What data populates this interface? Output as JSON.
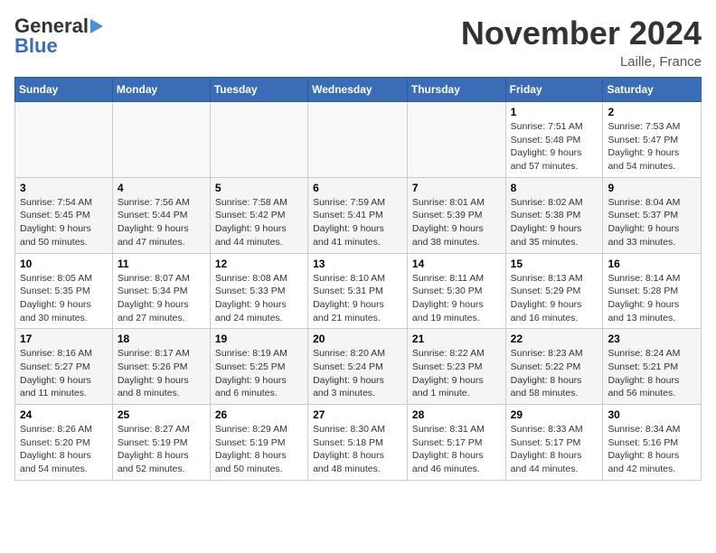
{
  "logo": {
    "line1": "General",
    "line2": "Blue"
  },
  "title": "November 2024",
  "location": "Laille, France",
  "days_of_week": [
    "Sunday",
    "Monday",
    "Tuesday",
    "Wednesday",
    "Thursday",
    "Friday",
    "Saturday"
  ],
  "weeks": [
    [
      {
        "num": "",
        "info": ""
      },
      {
        "num": "",
        "info": ""
      },
      {
        "num": "",
        "info": ""
      },
      {
        "num": "",
        "info": ""
      },
      {
        "num": "",
        "info": ""
      },
      {
        "num": "1",
        "info": "Sunrise: 7:51 AM\nSunset: 5:48 PM\nDaylight: 9 hours and 57 minutes."
      },
      {
        "num": "2",
        "info": "Sunrise: 7:53 AM\nSunset: 5:47 PM\nDaylight: 9 hours and 54 minutes."
      }
    ],
    [
      {
        "num": "3",
        "info": "Sunrise: 7:54 AM\nSunset: 5:45 PM\nDaylight: 9 hours and 50 minutes."
      },
      {
        "num": "4",
        "info": "Sunrise: 7:56 AM\nSunset: 5:44 PM\nDaylight: 9 hours and 47 minutes."
      },
      {
        "num": "5",
        "info": "Sunrise: 7:58 AM\nSunset: 5:42 PM\nDaylight: 9 hours and 44 minutes."
      },
      {
        "num": "6",
        "info": "Sunrise: 7:59 AM\nSunset: 5:41 PM\nDaylight: 9 hours and 41 minutes."
      },
      {
        "num": "7",
        "info": "Sunrise: 8:01 AM\nSunset: 5:39 PM\nDaylight: 9 hours and 38 minutes."
      },
      {
        "num": "8",
        "info": "Sunrise: 8:02 AM\nSunset: 5:38 PM\nDaylight: 9 hours and 35 minutes."
      },
      {
        "num": "9",
        "info": "Sunrise: 8:04 AM\nSunset: 5:37 PM\nDaylight: 9 hours and 33 minutes."
      }
    ],
    [
      {
        "num": "10",
        "info": "Sunrise: 8:05 AM\nSunset: 5:35 PM\nDaylight: 9 hours and 30 minutes."
      },
      {
        "num": "11",
        "info": "Sunrise: 8:07 AM\nSunset: 5:34 PM\nDaylight: 9 hours and 27 minutes."
      },
      {
        "num": "12",
        "info": "Sunrise: 8:08 AM\nSunset: 5:33 PM\nDaylight: 9 hours and 24 minutes."
      },
      {
        "num": "13",
        "info": "Sunrise: 8:10 AM\nSunset: 5:31 PM\nDaylight: 9 hours and 21 minutes."
      },
      {
        "num": "14",
        "info": "Sunrise: 8:11 AM\nSunset: 5:30 PM\nDaylight: 9 hours and 19 minutes."
      },
      {
        "num": "15",
        "info": "Sunrise: 8:13 AM\nSunset: 5:29 PM\nDaylight: 9 hours and 16 minutes."
      },
      {
        "num": "16",
        "info": "Sunrise: 8:14 AM\nSunset: 5:28 PM\nDaylight: 9 hours and 13 minutes."
      }
    ],
    [
      {
        "num": "17",
        "info": "Sunrise: 8:16 AM\nSunset: 5:27 PM\nDaylight: 9 hours and 11 minutes."
      },
      {
        "num": "18",
        "info": "Sunrise: 8:17 AM\nSunset: 5:26 PM\nDaylight: 9 hours and 8 minutes."
      },
      {
        "num": "19",
        "info": "Sunrise: 8:19 AM\nSunset: 5:25 PM\nDaylight: 9 hours and 6 minutes."
      },
      {
        "num": "20",
        "info": "Sunrise: 8:20 AM\nSunset: 5:24 PM\nDaylight: 9 hours and 3 minutes."
      },
      {
        "num": "21",
        "info": "Sunrise: 8:22 AM\nSunset: 5:23 PM\nDaylight: 9 hours and 1 minute."
      },
      {
        "num": "22",
        "info": "Sunrise: 8:23 AM\nSunset: 5:22 PM\nDaylight: 8 hours and 58 minutes."
      },
      {
        "num": "23",
        "info": "Sunrise: 8:24 AM\nSunset: 5:21 PM\nDaylight: 8 hours and 56 minutes."
      }
    ],
    [
      {
        "num": "24",
        "info": "Sunrise: 8:26 AM\nSunset: 5:20 PM\nDaylight: 8 hours and 54 minutes."
      },
      {
        "num": "25",
        "info": "Sunrise: 8:27 AM\nSunset: 5:19 PM\nDaylight: 8 hours and 52 minutes."
      },
      {
        "num": "26",
        "info": "Sunrise: 8:29 AM\nSunset: 5:19 PM\nDaylight: 8 hours and 50 minutes."
      },
      {
        "num": "27",
        "info": "Sunrise: 8:30 AM\nSunset: 5:18 PM\nDaylight: 8 hours and 48 minutes."
      },
      {
        "num": "28",
        "info": "Sunrise: 8:31 AM\nSunset: 5:17 PM\nDaylight: 8 hours and 46 minutes."
      },
      {
        "num": "29",
        "info": "Sunrise: 8:33 AM\nSunset: 5:17 PM\nDaylight: 8 hours and 44 minutes."
      },
      {
        "num": "30",
        "info": "Sunrise: 8:34 AM\nSunset: 5:16 PM\nDaylight: 8 hours and 42 minutes."
      }
    ]
  ]
}
